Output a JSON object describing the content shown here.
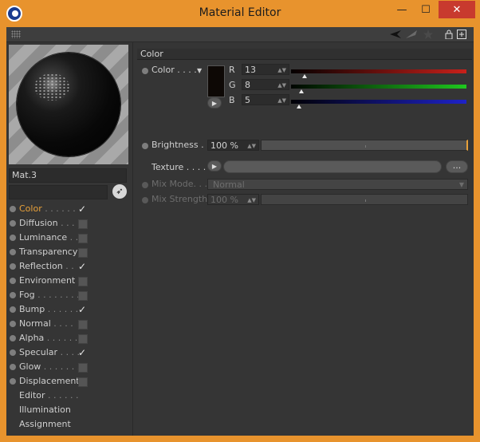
{
  "window": {
    "title": "Material Editor",
    "controls": {
      "minimize": "—",
      "maximize": "☐",
      "close": "✕"
    }
  },
  "toolbar": {
    "icons": [
      "grip-icon",
      "arrow-left-icon",
      "arrow-up-right-icon",
      "lock-icon",
      "new-window-icon"
    ]
  },
  "material": {
    "name": "Mat.3",
    "search": ""
  },
  "channels": [
    {
      "label": "Color",
      "dots": " . . . . . .",
      "checked": true,
      "active": true,
      "has_checkbox": true,
      "has_dot": true
    },
    {
      "label": "Diffusion",
      "dots": " . . .",
      "checked": false,
      "active": false,
      "has_checkbox": true,
      "has_dot": true
    },
    {
      "label": "Luminance",
      "dots": " . .",
      "checked": false,
      "active": false,
      "has_checkbox": true,
      "has_dot": true
    },
    {
      "label": "Transparency",
      "dots": "",
      "checked": false,
      "active": false,
      "has_checkbox": true,
      "has_dot": true
    },
    {
      "label": "Reflection",
      "dots": " . .",
      "checked": true,
      "active": false,
      "has_checkbox": true,
      "has_dot": true
    },
    {
      "label": "Environment",
      "dots": "",
      "checked": false,
      "active": false,
      "has_checkbox": true,
      "has_dot": true
    },
    {
      "label": "Fog",
      "dots": " . . . . . . . .",
      "checked": false,
      "active": false,
      "has_checkbox": true,
      "has_dot": true
    },
    {
      "label": "Bump",
      "dots": " . . . . . .",
      "checked": true,
      "active": false,
      "has_checkbox": true,
      "has_dot": true
    },
    {
      "label": "Normal",
      "dots": " . . . .",
      "checked": false,
      "active": false,
      "has_checkbox": true,
      "has_dot": true
    },
    {
      "label": "Alpha",
      "dots": " . . . . . .",
      "checked": false,
      "active": false,
      "has_checkbox": true,
      "has_dot": true
    },
    {
      "label": "Specular",
      "dots": " . . . .",
      "checked": true,
      "active": false,
      "has_checkbox": true,
      "has_dot": true
    },
    {
      "label": "Glow",
      "dots": " . . . . . . .",
      "checked": false,
      "active": false,
      "has_checkbox": true,
      "has_dot": true
    },
    {
      "label": "Displacement",
      "dots": "",
      "checked": false,
      "active": false,
      "has_checkbox": true,
      "has_dot": true
    },
    {
      "label": "Editor",
      "dots": " . . . . . .",
      "checked": false,
      "active": false,
      "has_checkbox": false,
      "has_dot": false
    },
    {
      "label": "Illumination",
      "dots": "",
      "checked": false,
      "active": false,
      "has_checkbox": false,
      "has_dot": false
    },
    {
      "label": "Assignment",
      "dots": "",
      "checked": false,
      "active": false,
      "has_checkbox": false,
      "has_dot": false
    }
  ],
  "color_panel": {
    "section_title": "Color",
    "color_label": "Color . . . .",
    "swatch_color": "#0d0805",
    "r": {
      "label": "R",
      "value": "13",
      "fraction": 0.051
    },
    "g": {
      "label": "G",
      "value": "8",
      "fraction": 0.031
    },
    "b": {
      "label": "B",
      "value": "5",
      "fraction": 0.02
    },
    "brightness_label": "Brightness . .",
    "brightness_value": "100 %",
    "texture_label": "Texture . . . . .",
    "texture_more": "...",
    "mix_mode_label": "Mix Mode. . .",
    "mix_mode_value": "Normal",
    "mix_strength_label": "Mix Strength",
    "mix_strength_value": "100 %"
  },
  "colors": {
    "accent": "#e8932d",
    "active_label": "#e8a13a",
    "close_button": "#c83a2e"
  }
}
